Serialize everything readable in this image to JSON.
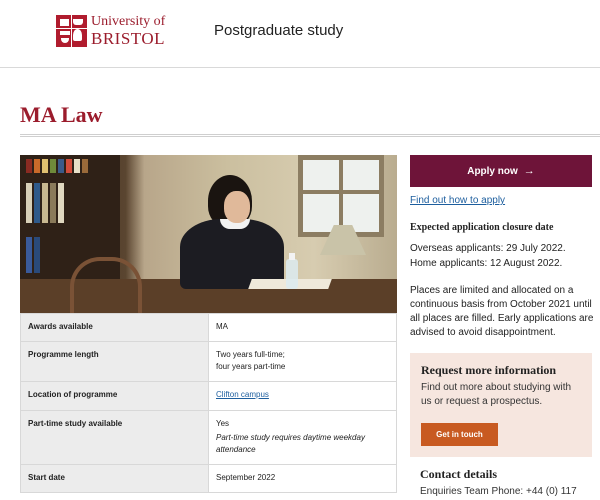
{
  "header": {
    "logo_line1": "University of",
    "logo_line2": "BRISTOL",
    "section_title": "Postgraduate study"
  },
  "page_title": "MA Law",
  "hero_image": {
    "description_icon": "student-studying-photo"
  },
  "facts": [
    {
      "label": "Awards available",
      "value": "MA"
    },
    {
      "label": "Programme length",
      "value": "Two years full-time;",
      "value2": "four years part-time"
    },
    {
      "label": "Location of programme",
      "value": "Clifton campus",
      "is_link": true
    },
    {
      "label": "Part-time study available",
      "value": "Yes",
      "note": "Part-time study requires daytime weekday attendance"
    },
    {
      "label": "Start date",
      "value": "September 2022"
    }
  ],
  "apply": {
    "button_label": "Apply now",
    "button_icon": "arrow-right-icon",
    "how_link": "Find out how to apply"
  },
  "closure": {
    "heading": "Expected application closure date",
    "overseas": "Overseas applicants: 29 July 2022.",
    "home": "Home applicants: 12 August 2022.",
    "places_text": "Places are limited and allocated on a continuous basis from October 2021 until all places are filled. Early applications are advised to avoid disappointment."
  },
  "request_info": {
    "title": "Request more information",
    "text": "Find out more about studying with us or request a prospectus.",
    "button_label": "Get in touch"
  },
  "contact": {
    "heading": "Contact details",
    "phone_line": "Enquiries Team Phone: +44 (0) 117"
  },
  "colors": {
    "brand_red": "#9b1c2c",
    "apply_button": "#6e1439",
    "touch_button": "#c85a21",
    "info_box_bg": "#f6e6df",
    "link": "#1d5e9e"
  }
}
